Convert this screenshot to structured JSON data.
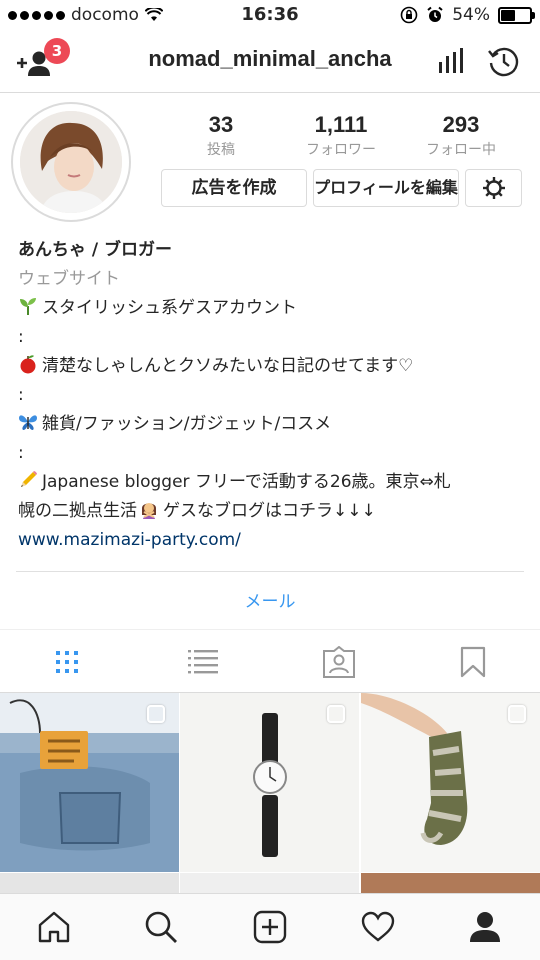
{
  "status_bar": {
    "carrier": "docomo",
    "time": "16:36",
    "battery": "54%",
    "battery_level": 0.54
  },
  "header": {
    "username": "nomad_minimal_ancha",
    "notification_count": "3",
    "icons": [
      "add-user-icon",
      "stats-icon",
      "history-icon"
    ]
  },
  "profile": {
    "stats": [
      {
        "value": "33",
        "label": "投稿"
      },
      {
        "value": "1,111",
        "label": "フォロワー"
      },
      {
        "value": "293",
        "label": "フォロー中"
      }
    ],
    "buttons": {
      "create_ad": "広告を作成",
      "edit_profile": "プロフィールを編集"
    },
    "name": "あんちゃ / ブロガー",
    "category": "ウェブサイト",
    "bio_lines": [
      "スタイリッシュ系ゲスアカウント",
      ":",
      "清楚なしゃしんとクソみたいな日記のせてます♡",
      ":",
      "雑貨/ファッション/ガジェット/コスメ",
      ":",
      "Japanese blogger フリーで活動する26歳。東京⇔札",
      "幌の二拠点生活",
      "ゲスなブログはコチラ↓↓↓"
    ],
    "bio_emojis": [
      "seedling",
      "apple",
      "butterfly",
      "pencil",
      "person-gesturing-no"
    ],
    "link": "www.mazimazi-party.com/",
    "mail_button": "メール"
  },
  "tabs": [
    "grid-icon",
    "list-icon",
    "tagged-icon",
    "saved-icon"
  ],
  "accent_color": "#3897f0",
  "bottom_nav": [
    "home-icon",
    "search-icon",
    "add-post-icon",
    "heart-icon",
    "profile-icon"
  ]
}
